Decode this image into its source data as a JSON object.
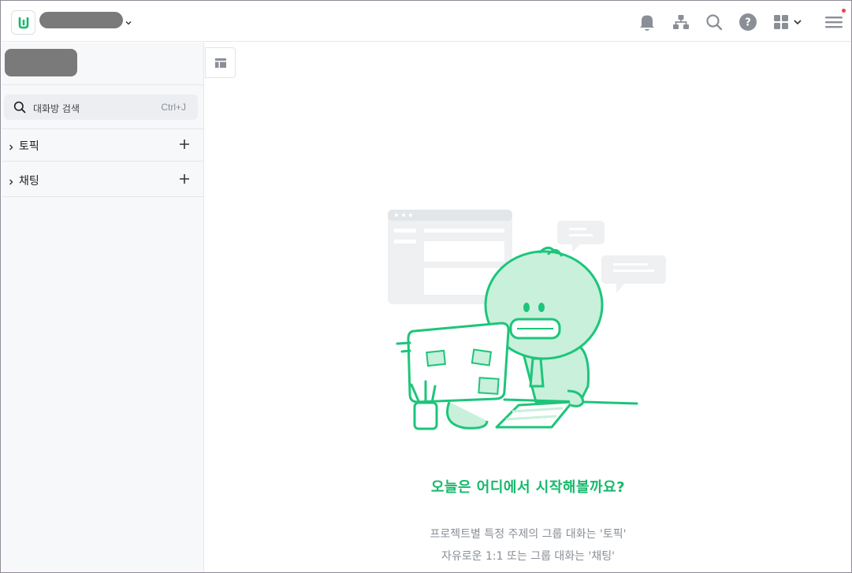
{
  "topbar": {
    "logo_icon": "workspace-logo-icon",
    "workspace_name": "",
    "icons": [
      "bell-icon",
      "org-chart-icon",
      "search-icon",
      "help-icon",
      "apps-grid-icon",
      "menu-icon"
    ],
    "help_glyph": "?"
  },
  "sidebar": {
    "search": {
      "placeholder": "대화방 검색",
      "shortcut": "Ctrl+J"
    },
    "sections": [
      {
        "label": "토픽"
      },
      {
        "label": "채팅"
      }
    ]
  },
  "main": {
    "headline": "오늘은 어디에서 시작해볼까요?",
    "desc_line1": "프로젝트별 특정 주제의 그룹 대화는 '토픽'",
    "desc_line2": "자유로운 1:1 또는 그룹 대화는 '채팅'"
  },
  "colors": {
    "brand_green": "#16b86b",
    "illustration_green": "#1dc57a",
    "illustration_light": "#c8f0da",
    "badge_red": "#ef4444"
  }
}
